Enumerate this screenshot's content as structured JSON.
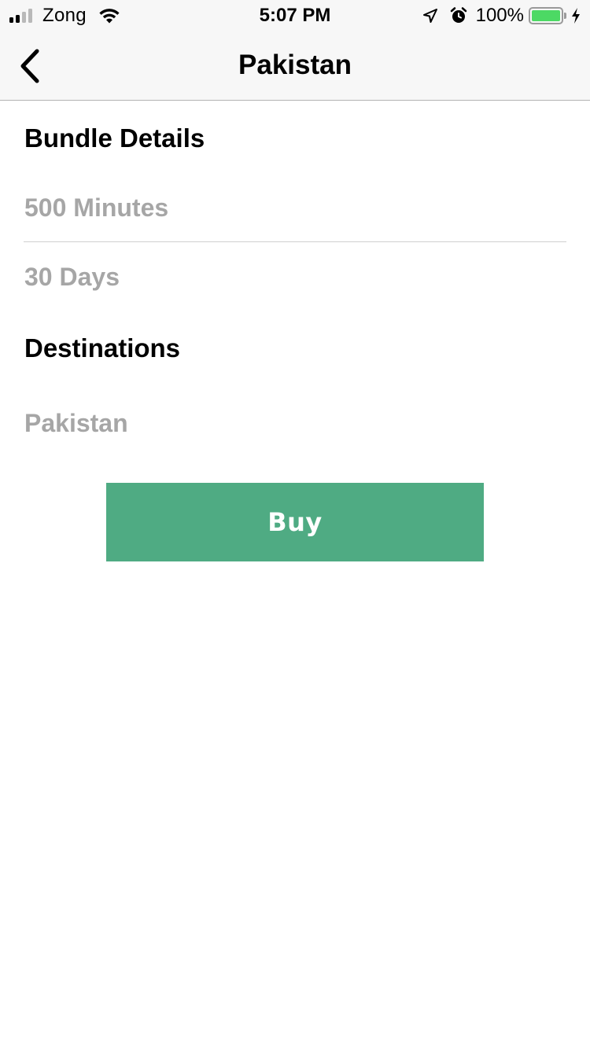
{
  "status_bar": {
    "carrier": "Zong",
    "time": "5:07 PM",
    "battery_percent": "100%",
    "battery_level": 1.0,
    "signal_bars_active": 2,
    "signal_bars_total": 4,
    "icons": [
      "signal-icon",
      "wifi-icon",
      "location-arrow-icon",
      "alarm-icon",
      "battery-icon",
      "charging-bolt-icon"
    ]
  },
  "nav": {
    "title": "Pakistan",
    "back_icon": "chevron-left-icon"
  },
  "bundle": {
    "header": "Bundle Details",
    "minutes": "500 Minutes",
    "validity": "30 Days"
  },
  "destinations": {
    "header": "Destinations",
    "items": [
      "Pakistan"
    ]
  },
  "actions": {
    "buy_label": "Buy"
  },
  "colors": {
    "accent": "#4fab83",
    "secondary_text": "#a6a6a6",
    "nav_background": "#f7f7f7",
    "battery_green": "#4cd964"
  }
}
